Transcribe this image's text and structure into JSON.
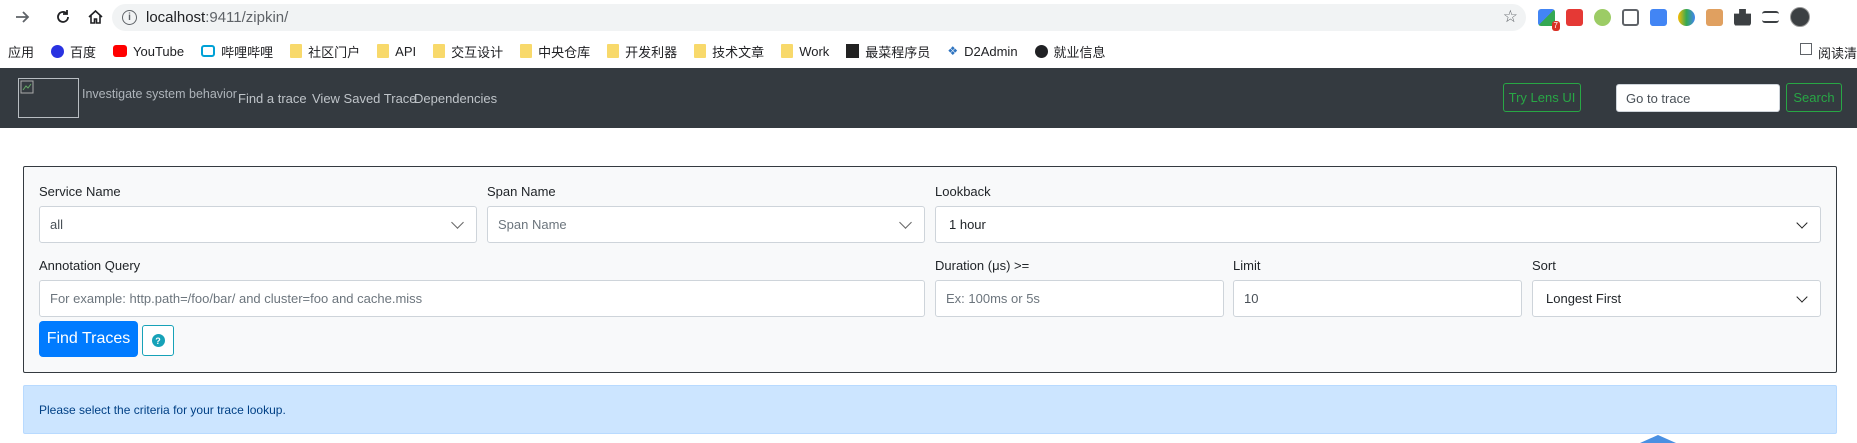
{
  "browser": {
    "url_host": "localhost",
    "url_path": ":9411/zipkin/",
    "extension_badge": "7",
    "nav_icons": [
      "forward-icon",
      "reload-icon",
      "home-icon"
    ]
  },
  "bookmarks": {
    "apps_label": "应用",
    "items": [
      {
        "label": "百度",
        "icon": "baidu-icon"
      },
      {
        "label": "YouTube",
        "icon": "youtube-icon"
      },
      {
        "label": "哔哩哔哩",
        "icon": "bilibili-icon"
      },
      {
        "label": "社区门户",
        "icon": "folder-icon"
      },
      {
        "label": "API",
        "icon": "folder-icon"
      },
      {
        "label": "交互设计",
        "icon": "folder-icon"
      },
      {
        "label": "中央仓库",
        "icon": "folder-icon"
      },
      {
        "label": "开发利器",
        "icon": "folder-icon"
      },
      {
        "label": "技术文章",
        "icon": "folder-icon"
      },
      {
        "label": "Work",
        "icon": "folder-icon"
      },
      {
        "label": "最菜程序员",
        "icon": "site-icon"
      },
      {
        "label": "D2Admin",
        "icon": "d2admin-icon"
      },
      {
        "label": "就业信息",
        "icon": "globe-icon"
      }
    ],
    "reading_list": "阅读清"
  },
  "navbar": {
    "tagline": "Investigate system behavior",
    "links": [
      "Find a trace",
      "View Saved Trace",
      "Dependencies"
    ],
    "lens_button": "Try Lens UI",
    "goto_placeholder": "Go to trace",
    "search_button": "Search",
    "brand_color": "#28a745"
  },
  "search": {
    "service_name_label": "Service Name",
    "service_name_value": "all",
    "span_name_label": "Span Name",
    "span_name_placeholder": "Span Name",
    "lookback_label": "Lookback",
    "lookback_value": "1 hour",
    "annotation_label": "Annotation Query",
    "annotation_placeholder": "For example: http.path=/foo/bar/ and cluster=foo and cache.miss",
    "duration_label": "Duration (μs) >=",
    "duration_placeholder": "Ex: 100ms or 5s",
    "limit_label": "Limit",
    "limit_value": "10",
    "sort_label": "Sort",
    "sort_value": "Longest First",
    "find_button": "Find Traces",
    "help_glyph": "?"
  },
  "alert": {
    "message": "Please select the criteria for your trace lookup."
  }
}
